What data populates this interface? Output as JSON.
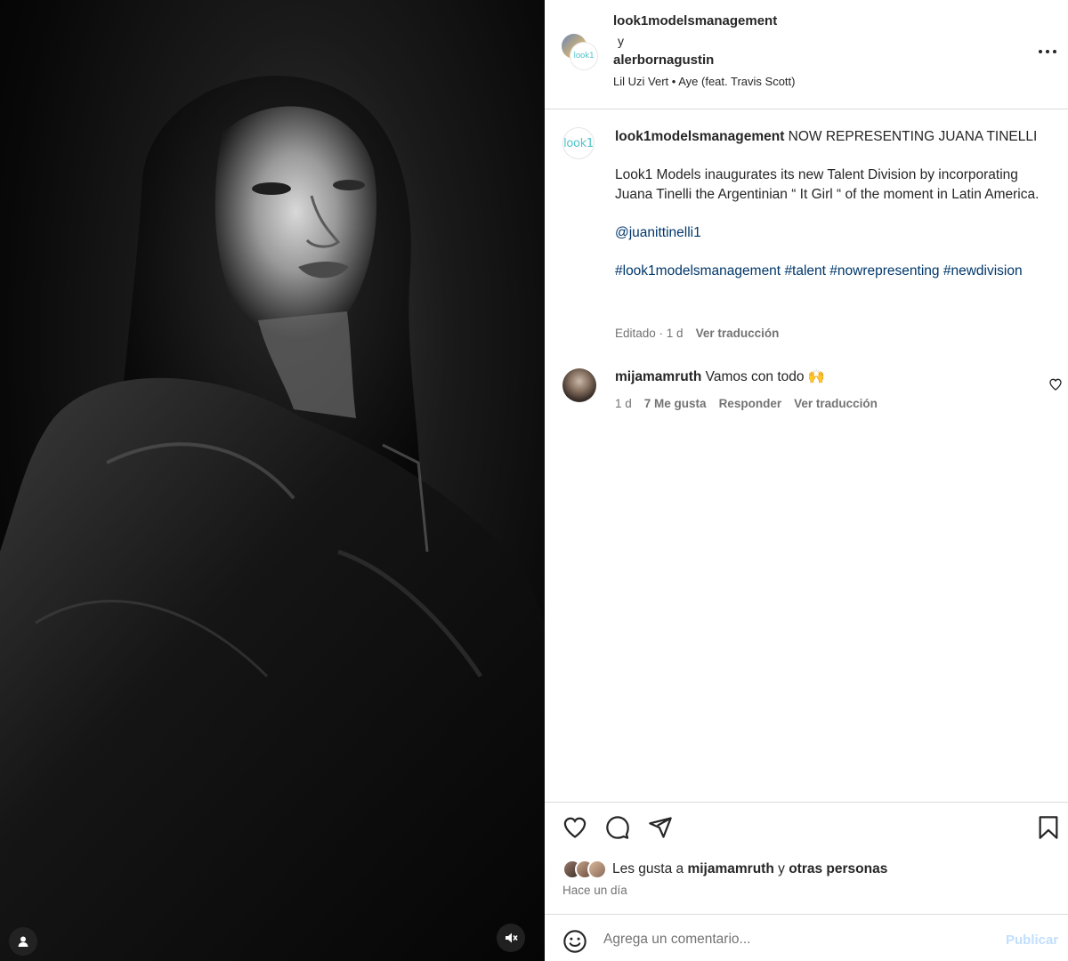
{
  "media": {
    "user_tags_icon": "user-icon",
    "mute_icon": "speaker-muted-icon"
  },
  "header": {
    "user1": "look1modelsmanagement",
    "and": "y",
    "user2": "alerbornagustin",
    "audio_artist": "Lil Uzi Vert",
    "audio_sep": "•",
    "audio_track": "Aye (feat. Travis Scott)",
    "avatar_logo": "look1",
    "more_icon": "more-dots-icon"
  },
  "caption": {
    "avatar_logo": "look1",
    "username": "look1modelsmanagement",
    "headline": "NOW REPRESENTING JUANA TINELLI",
    "paragraph": "Look1 Models inaugurates its new Talent Division by incorporating Juana Tinelli the Argentinian “ It Girl “ of the moment in Latin America.",
    "mention": "@juanittinelli1",
    "hashtags": [
      "#look1modelsmanagement",
      "#talent",
      "#nowrepresenting",
      "#newdivision"
    ],
    "meta_time": "Editado · 1 d",
    "translate": "Ver traducción"
  },
  "comment": {
    "username": "mijamamruth",
    "text": "Vamos con todo 🙌",
    "time": "1 d",
    "likes": "7 Me gusta",
    "reply": "Responder",
    "translate": "Ver traducción"
  },
  "actions": {
    "like_icon": "heart-icon",
    "comment_icon": "comment-icon",
    "share_icon": "paper-plane-icon",
    "save_icon": "bookmark-icon"
  },
  "likes": {
    "prefix": "Les gusta a",
    "user": "mijamamruth",
    "middle": "y",
    "others": "otras personas"
  },
  "time_ago": "Hace un día",
  "comment_bar": {
    "placeholder": "Agrega un comentario...",
    "post_label": "Publicar",
    "emoji_icon": "smiley-icon"
  },
  "colors": {
    "link": "#00376b",
    "muted": "#737373",
    "post_disabled": "#c0dffd",
    "divider": "#dbdbdb"
  }
}
